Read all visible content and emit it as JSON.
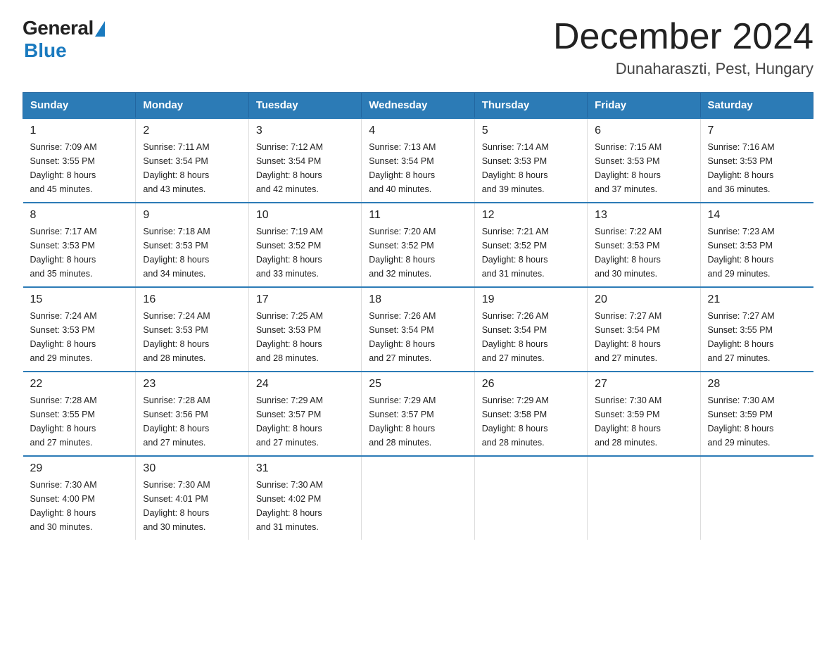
{
  "logo": {
    "general": "General",
    "blue": "Blue"
  },
  "title": {
    "month": "December 2024",
    "location": "Dunaharaszti, Pest, Hungary"
  },
  "weekdays": [
    "Sunday",
    "Monday",
    "Tuesday",
    "Wednesday",
    "Thursday",
    "Friday",
    "Saturday"
  ],
  "weeks": [
    [
      {
        "day": "1",
        "sunrise": "7:09 AM",
        "sunset": "3:55 PM",
        "daylight": "8 hours and 45 minutes."
      },
      {
        "day": "2",
        "sunrise": "7:11 AM",
        "sunset": "3:54 PM",
        "daylight": "8 hours and 43 minutes."
      },
      {
        "day": "3",
        "sunrise": "7:12 AM",
        "sunset": "3:54 PM",
        "daylight": "8 hours and 42 minutes."
      },
      {
        "day": "4",
        "sunrise": "7:13 AM",
        "sunset": "3:54 PM",
        "daylight": "8 hours and 40 minutes."
      },
      {
        "day": "5",
        "sunrise": "7:14 AM",
        "sunset": "3:53 PM",
        "daylight": "8 hours and 39 minutes."
      },
      {
        "day": "6",
        "sunrise": "7:15 AM",
        "sunset": "3:53 PM",
        "daylight": "8 hours and 37 minutes."
      },
      {
        "day": "7",
        "sunrise": "7:16 AM",
        "sunset": "3:53 PM",
        "daylight": "8 hours and 36 minutes."
      }
    ],
    [
      {
        "day": "8",
        "sunrise": "7:17 AM",
        "sunset": "3:53 PM",
        "daylight": "8 hours and 35 minutes."
      },
      {
        "day": "9",
        "sunrise": "7:18 AM",
        "sunset": "3:53 PM",
        "daylight": "8 hours and 34 minutes."
      },
      {
        "day": "10",
        "sunrise": "7:19 AM",
        "sunset": "3:52 PM",
        "daylight": "8 hours and 33 minutes."
      },
      {
        "day": "11",
        "sunrise": "7:20 AM",
        "sunset": "3:52 PM",
        "daylight": "8 hours and 32 minutes."
      },
      {
        "day": "12",
        "sunrise": "7:21 AM",
        "sunset": "3:52 PM",
        "daylight": "8 hours and 31 minutes."
      },
      {
        "day": "13",
        "sunrise": "7:22 AM",
        "sunset": "3:53 PM",
        "daylight": "8 hours and 30 minutes."
      },
      {
        "day": "14",
        "sunrise": "7:23 AM",
        "sunset": "3:53 PM",
        "daylight": "8 hours and 29 minutes."
      }
    ],
    [
      {
        "day": "15",
        "sunrise": "7:24 AM",
        "sunset": "3:53 PM",
        "daylight": "8 hours and 29 minutes."
      },
      {
        "day": "16",
        "sunrise": "7:24 AM",
        "sunset": "3:53 PM",
        "daylight": "8 hours and 28 minutes."
      },
      {
        "day": "17",
        "sunrise": "7:25 AM",
        "sunset": "3:53 PM",
        "daylight": "8 hours and 28 minutes."
      },
      {
        "day": "18",
        "sunrise": "7:26 AM",
        "sunset": "3:54 PM",
        "daylight": "8 hours and 27 minutes."
      },
      {
        "day": "19",
        "sunrise": "7:26 AM",
        "sunset": "3:54 PM",
        "daylight": "8 hours and 27 minutes."
      },
      {
        "day": "20",
        "sunrise": "7:27 AM",
        "sunset": "3:54 PM",
        "daylight": "8 hours and 27 minutes."
      },
      {
        "day": "21",
        "sunrise": "7:27 AM",
        "sunset": "3:55 PM",
        "daylight": "8 hours and 27 minutes."
      }
    ],
    [
      {
        "day": "22",
        "sunrise": "7:28 AM",
        "sunset": "3:55 PM",
        "daylight": "8 hours and 27 minutes."
      },
      {
        "day": "23",
        "sunrise": "7:28 AM",
        "sunset": "3:56 PM",
        "daylight": "8 hours and 27 minutes."
      },
      {
        "day": "24",
        "sunrise": "7:29 AM",
        "sunset": "3:57 PM",
        "daylight": "8 hours and 27 minutes."
      },
      {
        "day": "25",
        "sunrise": "7:29 AM",
        "sunset": "3:57 PM",
        "daylight": "8 hours and 28 minutes."
      },
      {
        "day": "26",
        "sunrise": "7:29 AM",
        "sunset": "3:58 PM",
        "daylight": "8 hours and 28 minutes."
      },
      {
        "day": "27",
        "sunrise": "7:30 AM",
        "sunset": "3:59 PM",
        "daylight": "8 hours and 28 minutes."
      },
      {
        "day": "28",
        "sunrise": "7:30 AM",
        "sunset": "3:59 PM",
        "daylight": "8 hours and 29 minutes."
      }
    ],
    [
      {
        "day": "29",
        "sunrise": "7:30 AM",
        "sunset": "4:00 PM",
        "daylight": "8 hours and 30 minutes."
      },
      {
        "day": "30",
        "sunrise": "7:30 AM",
        "sunset": "4:01 PM",
        "daylight": "8 hours and 30 minutes."
      },
      {
        "day": "31",
        "sunrise": "7:30 AM",
        "sunset": "4:02 PM",
        "daylight": "8 hours and 31 minutes."
      },
      null,
      null,
      null,
      null
    ]
  ],
  "labels": {
    "sunrise": "Sunrise:",
    "sunset": "Sunset:",
    "daylight": "Daylight:"
  }
}
